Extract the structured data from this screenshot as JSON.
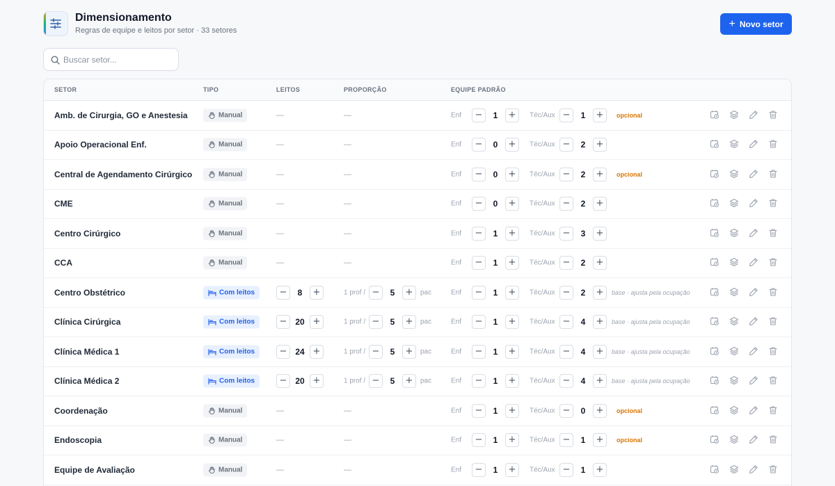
{
  "header": {
    "title": "Dimensionamento",
    "subtitle": "Regras de equipe e leitos por setor · 33 setores",
    "new_button": "Novo setor"
  },
  "search": {
    "placeholder": "Buscar setor..."
  },
  "table": {
    "columns": {
      "sector": "SETOR",
      "type": "TIPO",
      "beds": "LEITOS",
      "ratio": "PROPORÇÃO",
      "team": "EQUIPE PADRÃO"
    },
    "labels": {
      "enf": "Enf",
      "tec": "Téc/Aux",
      "prof": "1 prof /",
      "pac": "pac",
      "dash": "—"
    },
    "rows": [
      {
        "sector": "Amb. de Cirurgia, GO e Anestesia",
        "type": "Manual",
        "enf": "1",
        "tec": "1",
        "note": "opcional"
      },
      {
        "sector": "Apoio Operacional Enf.",
        "type": "Manual",
        "enf": "0",
        "tec": "2",
        "note": ""
      },
      {
        "sector": "Central de Agendamento Cirúrgico",
        "type": "Manual",
        "enf": "0",
        "tec": "2",
        "note": "opcional"
      },
      {
        "sector": "CME",
        "type": "Manual",
        "enf": "0",
        "tec": "2",
        "note": ""
      },
      {
        "sector": "Centro Cirúrgico",
        "type": "Manual",
        "enf": "1",
        "tec": "3",
        "note": ""
      },
      {
        "sector": "CCA",
        "type": "Manual",
        "enf": "1",
        "tec": "2",
        "note": ""
      },
      {
        "sector": "Centro Obstétrico",
        "type": "Com leitos",
        "beds": "8",
        "ratio": "5",
        "enf": "1",
        "tec": "2",
        "note": "base · ajusta pela ocupação"
      },
      {
        "sector": "Clínica Cirúrgica",
        "type": "Com leitos",
        "beds": "20",
        "ratio": "5",
        "enf": "1",
        "tec": "4",
        "note": "base · ajusta pela ocupação"
      },
      {
        "sector": "Clínica Médica 1",
        "type": "Com leitos",
        "beds": "24",
        "ratio": "5",
        "enf": "1",
        "tec": "4",
        "note": "base · ajusta pela ocupação"
      },
      {
        "sector": "Clínica Médica 2",
        "type": "Com leitos",
        "beds": "20",
        "ratio": "5",
        "enf": "1",
        "tec": "4",
        "note": "base · ajusta pela ocupação"
      },
      {
        "sector": "Coordenação",
        "type": "Manual",
        "enf": "1",
        "tec": "0",
        "note": "opcional"
      },
      {
        "sector": "Endoscopia",
        "type": "Manual",
        "enf": "1",
        "tec": "1",
        "note": "opcional"
      },
      {
        "sector": "Equipe de Avaliação",
        "type": "Manual",
        "enf": "1",
        "tec": "1",
        "note": ""
      }
    ]
  },
  "colors": {
    "primary": "#1d63ed",
    "badge_blue": "#2563eb",
    "optional": "#d97706"
  },
  "icons": {
    "logo": "sliders-icon",
    "search": "search-icon",
    "manual_type": "hand-icon",
    "beds_type": "bed-icon",
    "actions": [
      "calendar-clock-icon",
      "layers-icon",
      "pencil-icon",
      "trash-icon"
    ]
  }
}
